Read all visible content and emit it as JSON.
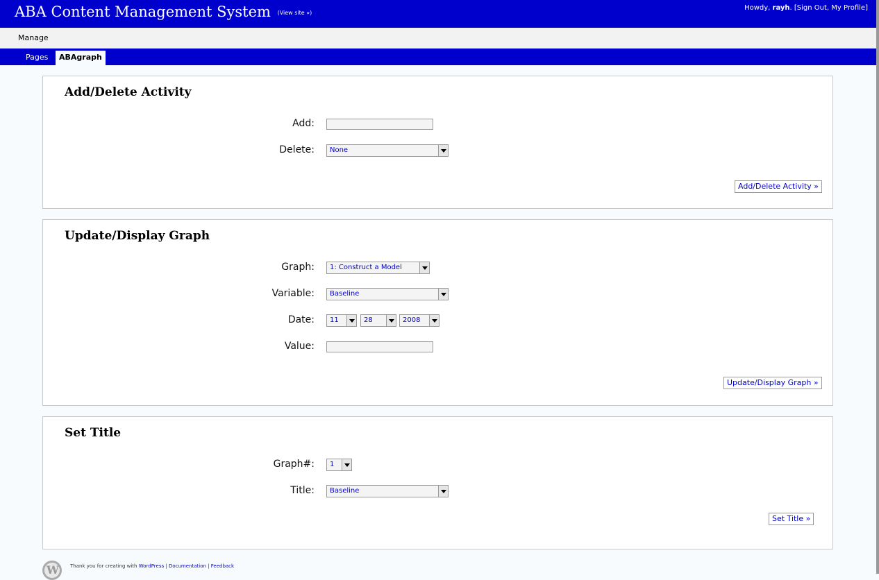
{
  "header": {
    "title": "ABA Content Management System",
    "view_site": "(View site »)",
    "howdy": "Howdy,",
    "username": "rayh",
    "account_links": ". [Sign Out, My Profile]"
  },
  "nav": {
    "manage": "Manage"
  },
  "subnav": {
    "pages": "Pages",
    "abagraph": "ABAgraph"
  },
  "add_delete": {
    "heading": "Add/Delete Activity",
    "add_label": "Add:",
    "add_value": "",
    "delete_label": "Delete:",
    "delete_selected": "None",
    "button": "Add/Delete Activity »"
  },
  "update_display": {
    "heading": "Update/Display Graph",
    "graph_label": "Graph:",
    "graph_selected": "1: Construct a Model",
    "variable_label": "Variable:",
    "variable_selected": "Baseline",
    "date_label": "Date:",
    "month_selected": "11",
    "day_selected": "28",
    "year_selected": "2008",
    "value_label": "Value:",
    "value_value": "",
    "button": "Update/Display Graph »"
  },
  "set_title": {
    "heading": "Set Title",
    "graph_num_label": "Graph#:",
    "graph_num_selected": "1",
    "title_label": "Title:",
    "title_selected": "Baseline",
    "button": "Set Title »"
  },
  "footer": {
    "thanks": "Thank you for creating with",
    "wordpress": "WordPress",
    "sep1": "|",
    "documentation": "Documentation",
    "sep2": "|",
    "feedback": "Feedback"
  }
}
